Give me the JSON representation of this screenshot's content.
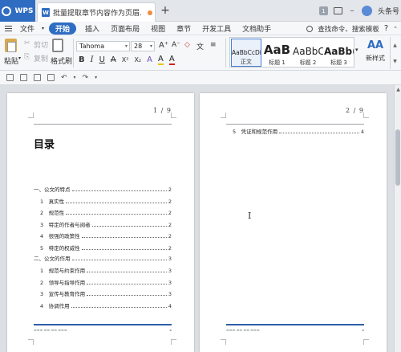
{
  "titlebar": {
    "app_tab": "WPS",
    "doc_tab": "批量提取章节内容作为页眉.docx",
    "badge": "1",
    "user_label": "头条号"
  },
  "menubar": {
    "file": "文件",
    "items": [
      "开始",
      "插入",
      "页面布局",
      "视图",
      "章节",
      "开发工具",
      "文档助手"
    ],
    "search": "查找命令、搜索模板",
    "help": "?"
  },
  "ribbon": {
    "paste": "粘贴",
    "cut": "剪切",
    "copy": "复制",
    "format_painter": "格式刷",
    "font_name": "Tahoma",
    "font_size": "28",
    "format_buttons": [
      "B",
      "I",
      "U",
      "A",
      "X²",
      "X₂",
      "A",
      "A",
      "A"
    ],
    "styles": [
      {
        "sample": "AaBbCcDi",
        "name": "正文"
      },
      {
        "sample": "AaB",
        "name": "标题 1"
      },
      {
        "sample": "AaBbC",
        "name": "标题 2"
      },
      {
        "sample": "AaBb(",
        "name": "标题 3"
      }
    ],
    "new_style": "新样式",
    "new_style_glyph": "AA"
  },
  "document": {
    "page1": {
      "page_number": "1 / 9",
      "heading": "目录",
      "toc": [
        {
          "label": "一、公文的特点",
          "page": "2",
          "level": 1
        },
        {
          "label": "1　真实性",
          "page": "2",
          "level": 2
        },
        {
          "label": "2　规范性",
          "page": "2",
          "level": 2
        },
        {
          "label": "3　特定的作者与阅者",
          "page": "2",
          "level": 2
        },
        {
          "label": "4　很强的政策性",
          "page": "2",
          "level": 2
        },
        {
          "label": "5　特定的权威性",
          "page": "2",
          "level": 2
        },
        {
          "label": "二、公文的作用",
          "page": "3",
          "level": 1
        },
        {
          "label": "1　规范与约束作用",
          "page": "3",
          "level": 2
        },
        {
          "label": "2　领导与指导作用",
          "page": "3",
          "level": 2
        },
        {
          "label": "3　宣传与教育作用",
          "page": "3",
          "level": 2
        },
        {
          "label": "4　协调作用",
          "page": "4",
          "level": 2
        }
      ]
    },
    "page2": {
      "page_number": "2 / 9",
      "toc": [
        {
          "label": "5　凭证和规范作用",
          "page": "4",
          "level": 2
        }
      ]
    }
  },
  "colors": {
    "accent": "#2f6dc2",
    "footer_bar": "#2f5fa8",
    "doc_background": "#dcdfe3"
  }
}
